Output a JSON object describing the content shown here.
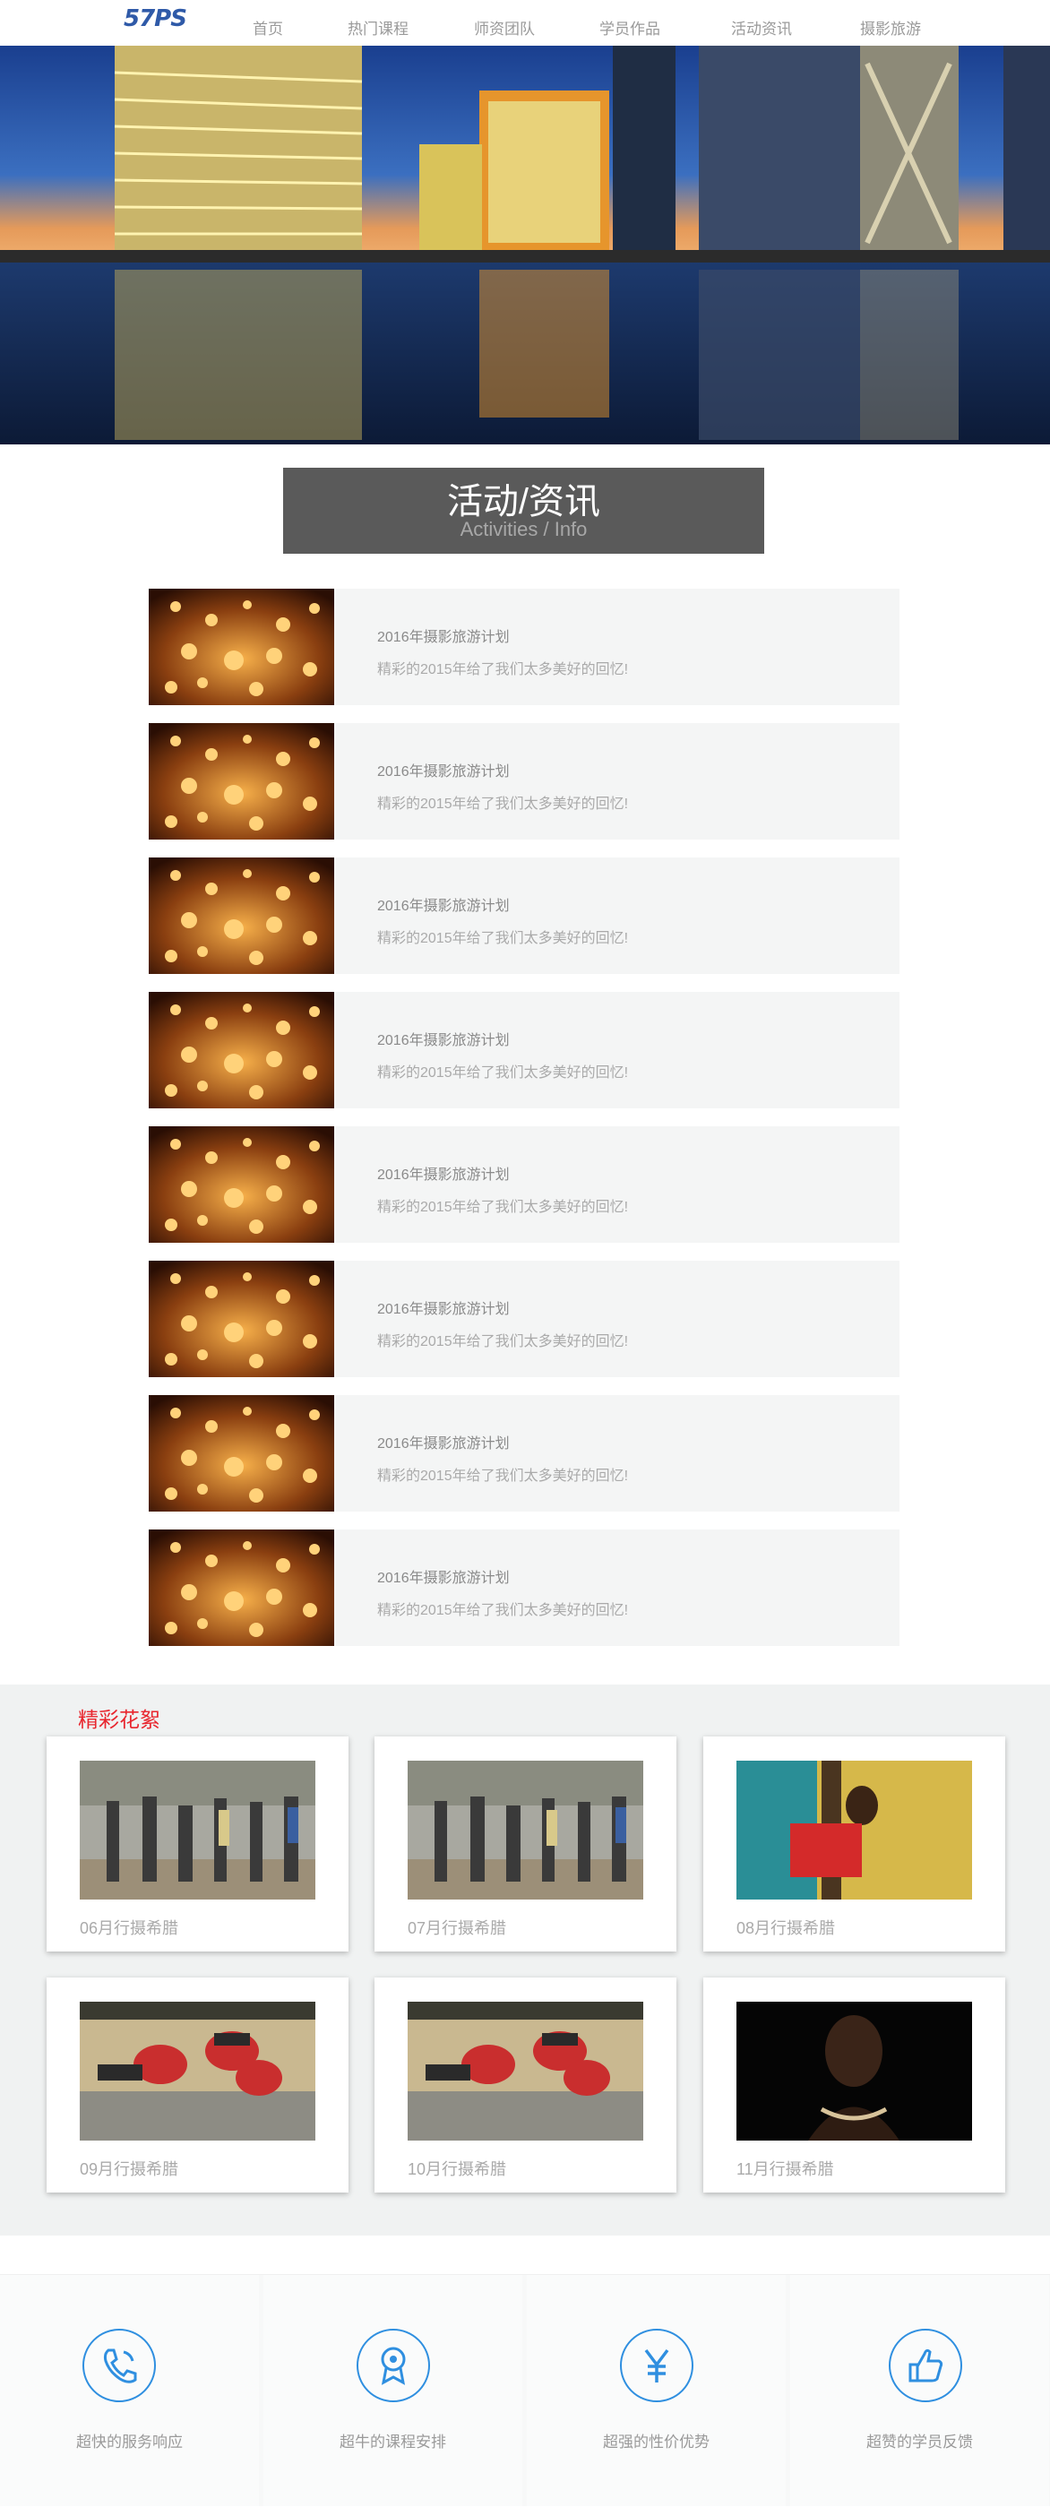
{
  "nav": {
    "logo": "57PS",
    "items": [
      "首页",
      "热门课程",
      "师资团队",
      "学员作品",
      "活动资讯",
      "摄影旅游"
    ]
  },
  "section": {
    "title_cn": "活动/资讯",
    "title_en": "Activities / Info"
  },
  "news": [
    {
      "title": "2016年摄影旅游计划",
      "desc": "精彩的2015年给了我们太多美好的回忆!"
    },
    {
      "title": "2016年摄影旅游计划",
      "desc": "精彩的2015年给了我们太多美好的回忆!"
    },
    {
      "title": "2016年摄影旅游计划",
      "desc": "精彩的2015年给了我们太多美好的回忆!"
    },
    {
      "title": "2016年摄影旅游计划",
      "desc": "精彩的2015年给了我们太多美好的回忆!"
    },
    {
      "title": "2016年摄影旅游计划",
      "desc": "精彩的2015年给了我们太多美好的回忆!"
    },
    {
      "title": "2016年摄影旅游计划",
      "desc": "精彩的2015年给了我们太多美好的回忆!"
    },
    {
      "title": "2016年摄影旅游计划",
      "desc": "精彩的2015年给了我们太多美好的回忆!"
    },
    {
      "title": "2016年摄影旅游计划",
      "desc": "精彩的2015年给了我们太多美好的回忆!"
    }
  ],
  "gallery": {
    "title": "精彩花絮",
    "cards": [
      "06月行摄希腊",
      "07月行摄希腊",
      "08月行摄希腊",
      "09月行摄希腊",
      "10月行摄希腊",
      "11月行摄希腊"
    ]
  },
  "features": [
    "超快的服务响应",
    "超牛的课程安排",
    "超强的性价优势",
    "超赞的学员反馈"
  ],
  "colors": {
    "accent": "#2f8fe0",
    "gallery_title": "#e8262e",
    "title_box": "#5a5a5a"
  }
}
